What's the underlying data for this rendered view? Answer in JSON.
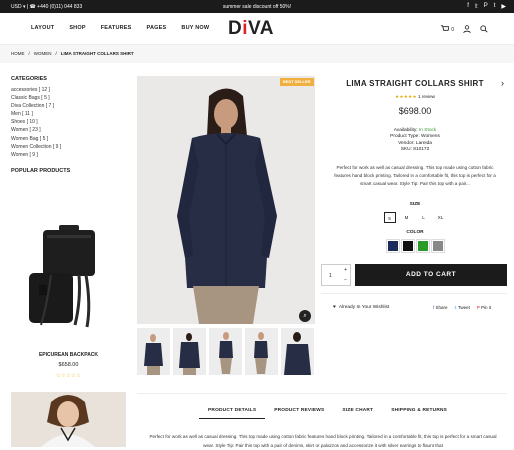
{
  "topbar": {
    "currency": "USD ▾  |  ☎ +440 (0)11) 044 833",
    "announcement": "summer sale discount off 50%!",
    "social": [
      "f-icon",
      "twitter-icon",
      "pinterest-icon",
      "tumblr-icon",
      "youtube-icon"
    ]
  },
  "nav": {
    "items": [
      "LAYOUT",
      "SHOP",
      "FEATURES",
      "PAGES",
      "BUY NOW"
    ],
    "logo_pre": "D",
    "logo_i": "i",
    "logo_post": "VA",
    "cart_count": "0"
  },
  "breadcrumb": [
    "HOME",
    "/",
    "WOMEN",
    "/",
    "LIMA STRAIGHT COLLARS SHIRT"
  ],
  "sidebar": {
    "categories_title": "CATEGORIES",
    "categories": [
      "accessories [ 12 ]",
      "Classic Bags [ 5 ]",
      "Diva Collection [ 7 ]",
      "Men [ 11 ]",
      "Shoes [ 10 ]",
      "Women [ 23 ]",
      "Women Bag [ 5 ]",
      "Women Collection [ 9 ]",
      "Women [ 9 ]"
    ],
    "popular_title": "POPULAR PRODUCTS",
    "popular_name": "EPICUREAN BACKPACK",
    "popular_price": "$658.00",
    "popular_stars": "☆☆☆☆☆"
  },
  "gallery": {
    "badge": "BEST SELLER"
  },
  "product": {
    "title": "LIMA STRAIGHT COLLARS SHIRT",
    "stars": "★★★★★",
    "review": "1 review",
    "price": "$698.00",
    "availability_label": "Availability:",
    "availability_value": "In Stock",
    "type_line": "Product Type:  Womens",
    "vendor_line": "Vendor:  Lareida",
    "sku_line": "SKU:  810172",
    "description": "Perfect for work as well as casual dressing. This top made using cotton fabric features hand block printing. Tailored in a comfortable fit, this top is perfect for a smart casual wear. Style Tip: Pair this top with a pair...",
    "size_label": "SIZE",
    "sizes": [
      "S",
      "M",
      "L",
      "XL"
    ],
    "color_label": "COLOR",
    "colors": [
      "#1c2a5c",
      "#111111",
      "#2a9a2a",
      "#888888"
    ],
    "qty": "1",
    "add_to_cart": "ADD TO CART",
    "wishlist": "Already In Your Wishlist",
    "share": [
      "Share",
      "Tweet",
      "Pin it"
    ]
  },
  "tabs": {
    "items": [
      "PRODUCT DETAILS",
      "PRODUCT REVIEWS",
      "SIZE CHART",
      "SHIPPING & RETURNS"
    ],
    "text": "Perfect for work as well as casual dressing. This top made using cotton fabric features hand block printing. Tailored in a comfortable fit, this top is perfect for a smart casual wear. Style Tip: Pair this top with a pair of denims, skirt or palazzos and accessorize it with silver earrings to flaunt that"
  }
}
